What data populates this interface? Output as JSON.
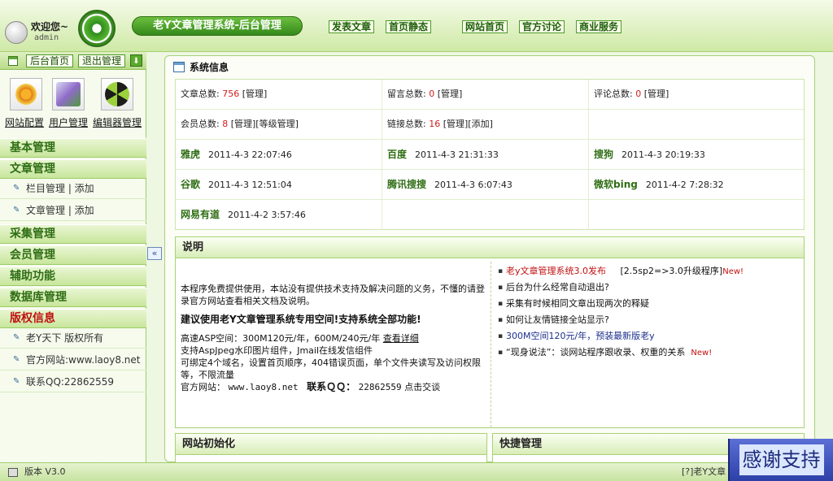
{
  "header": {
    "welcome": "欢迎您~",
    "username": "admin",
    "system_title": "老Y文章管理系统-后台管理",
    "nav": [
      {
        "label": "发表文章"
      },
      {
        "label": "首页静态"
      },
      {
        "label": "网站首页"
      },
      {
        "label": "官方讨论"
      },
      {
        "label": "商业服务"
      }
    ]
  },
  "sidebar": {
    "top_buttons": [
      {
        "label": "后台首页"
      },
      {
        "label": "退出管理"
      }
    ],
    "tools": [
      {
        "label": "网站配置",
        "icon": "gears-icon"
      },
      {
        "label": "用户管理",
        "icon": "users-icon"
      },
      {
        "label": "编辑器管理",
        "icon": "radiation-icon"
      }
    ],
    "sections": [
      {
        "title": "基本管理"
      },
      {
        "title": "文章管理"
      },
      {
        "title": "采集管理"
      },
      {
        "title": "会员管理"
      },
      {
        "title": "辅助功能"
      },
      {
        "title": "数据库管理"
      },
      {
        "title": "版权信息"
      }
    ],
    "article_subs": [
      {
        "label": "栏目管理 | 添加"
      },
      {
        "label": "文章管理 | 添加"
      }
    ],
    "copyright_subs": [
      {
        "label": "老Y天下 版权所有"
      },
      {
        "label": "官方网站:www.laoy8.net"
      },
      {
        "label": "联系QQ:22862559"
      }
    ]
  },
  "system_info": {
    "title": "系统信息",
    "articles_label": "文章总数:",
    "articles_count": "756",
    "articles_action": "[管理]",
    "messages_label": "留言总数:",
    "messages_count": "0",
    "messages_action": "[管理]",
    "comments_label": "评论总数:",
    "comments_count": "0",
    "comments_action": "[管理]",
    "members_label": "会员总数:",
    "members_count": "8",
    "members_action": "[管理][等级管理]",
    "links_label": "链接总数:",
    "links_count": "16",
    "links_action": "[管理][添加]",
    "spiders": [
      {
        "name": "雅虎",
        "time": "2011-4-3 22:07:46"
      },
      {
        "name": "百度",
        "time": "2011-4-3 21:31:33"
      },
      {
        "name": "搜狗",
        "time": "2011-4-3 20:19:33"
      },
      {
        "name": "谷歌",
        "time": "2011-4-3 12:51:04"
      },
      {
        "name": "腾讯搜搜",
        "time": "2011-4-3 6:07:43"
      },
      {
        "name": "微软bing",
        "time": "2011-4-2 7:28:32"
      },
      {
        "name": "网易有道",
        "time": "2011-4-2 3:57:46"
      }
    ]
  },
  "description": {
    "title": "说明",
    "para1": "本程序免费提供使用，本站没有提供技术支持及解决问题的义务，不懂的请登录官方网站查看相关文档及说明。",
    "para2": "建议使用老Y文章管理系统专用空间!支持系统全部功能!",
    "space_prefix": "高速ASP空间：300M120元/年，600M/240元/年",
    "space_link": "查看详细",
    "support": "支持AspJpeg水印图片组件，Jmail在线发信组件",
    "domains": "可绑定4个域名，设置首页顺序，404错误页面，单个文件夹读写及访问权限等，不限流量",
    "site_label": "官方网站：",
    "site_url": "www.laoy8.net",
    "qq_label": "联系ＱＱ：",
    "qq_number": "22862559",
    "chat_link": "点击交谈",
    "news": [
      {
        "text": "老y文章管理系统3.0发布",
        "extra": "[2.5sp2=>3.0升级程序]",
        "badge": "New!"
      },
      {
        "text": "后台为什么经常自动退出?"
      },
      {
        "text": "采集有时候相同文章出现两次的释疑"
      },
      {
        "text": "如何让友情链接全站显示?"
      },
      {
        "text": "300M空间120元/年，预装最新版老y"
      },
      {
        "text": "“现身说法”：谈网站程序跟收录、权重的关系",
        "badge": "New!"
      }
    ]
  },
  "bottom_boxes": [
    {
      "title": "网站初始化"
    },
    {
      "title": "快捷管理"
    }
  ],
  "footer": {
    "version": "版本 V3.0",
    "right_text": "老Y文章"
  },
  "thanks_banner": "感谢支持",
  "colors": {
    "accent": "#34891a",
    "highlight": "#d21c1c"
  }
}
